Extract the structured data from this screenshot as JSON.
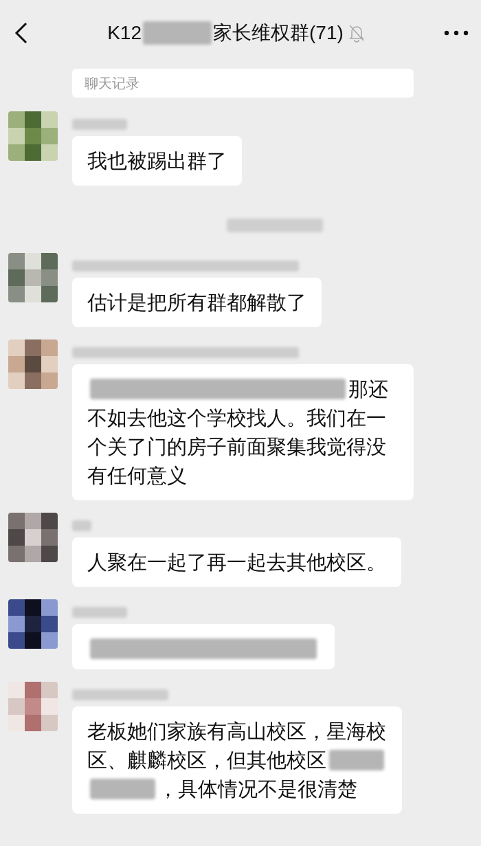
{
  "header": {
    "title_parts": [
      {
        "kind": "text",
        "text": "K12"
      },
      {
        "kind": "blur"
      },
      {
        "kind": "text",
        "text": "家长维权群(71)"
      }
    ],
    "muted": true
  },
  "search": {
    "placeholder": "聊天记录"
  },
  "messages": [
    {
      "kind": "message",
      "lines": [
        [
          {
            "kind": "text",
            "text": "我也被踢出群了"
          }
        ]
      ]
    },
    {
      "kind": "notice"
    },
    {
      "kind": "message",
      "lines": [
        [
          {
            "kind": "text",
            "text": "估计是把所有群都解散了"
          }
        ]
      ]
    },
    {
      "kind": "message",
      "lines": [
        [
          {
            "kind": "blur"
          },
          {
            "kind": "text",
            "text": "那还"
          }
        ],
        [
          {
            "kind": "text",
            "text": "不如去他这个学校找人。我们在一个关了门的房子前面聚集我觉得没有任何意义"
          }
        ]
      ]
    },
    {
      "kind": "message",
      "lines": [
        [
          {
            "kind": "text",
            "text": "人聚在一起了再一起去其他校区。"
          }
        ]
      ]
    },
    {
      "kind": "message",
      "lines": [
        [
          {
            "kind": "blur"
          }
        ]
      ]
    },
    {
      "kind": "message",
      "lines": [
        [
          {
            "kind": "text",
            "text": "老板她们家族有高山校区，星海校"
          }
        ],
        [
          {
            "kind": "text",
            "text": "区、麒麟校区，但其他校区"
          },
          {
            "kind": "blur"
          }
        ],
        [
          {
            "kind": "blur"
          },
          {
            "kind": "text",
            "text": "，具体情况不是很清楚"
          }
        ]
      ]
    }
  ]
}
